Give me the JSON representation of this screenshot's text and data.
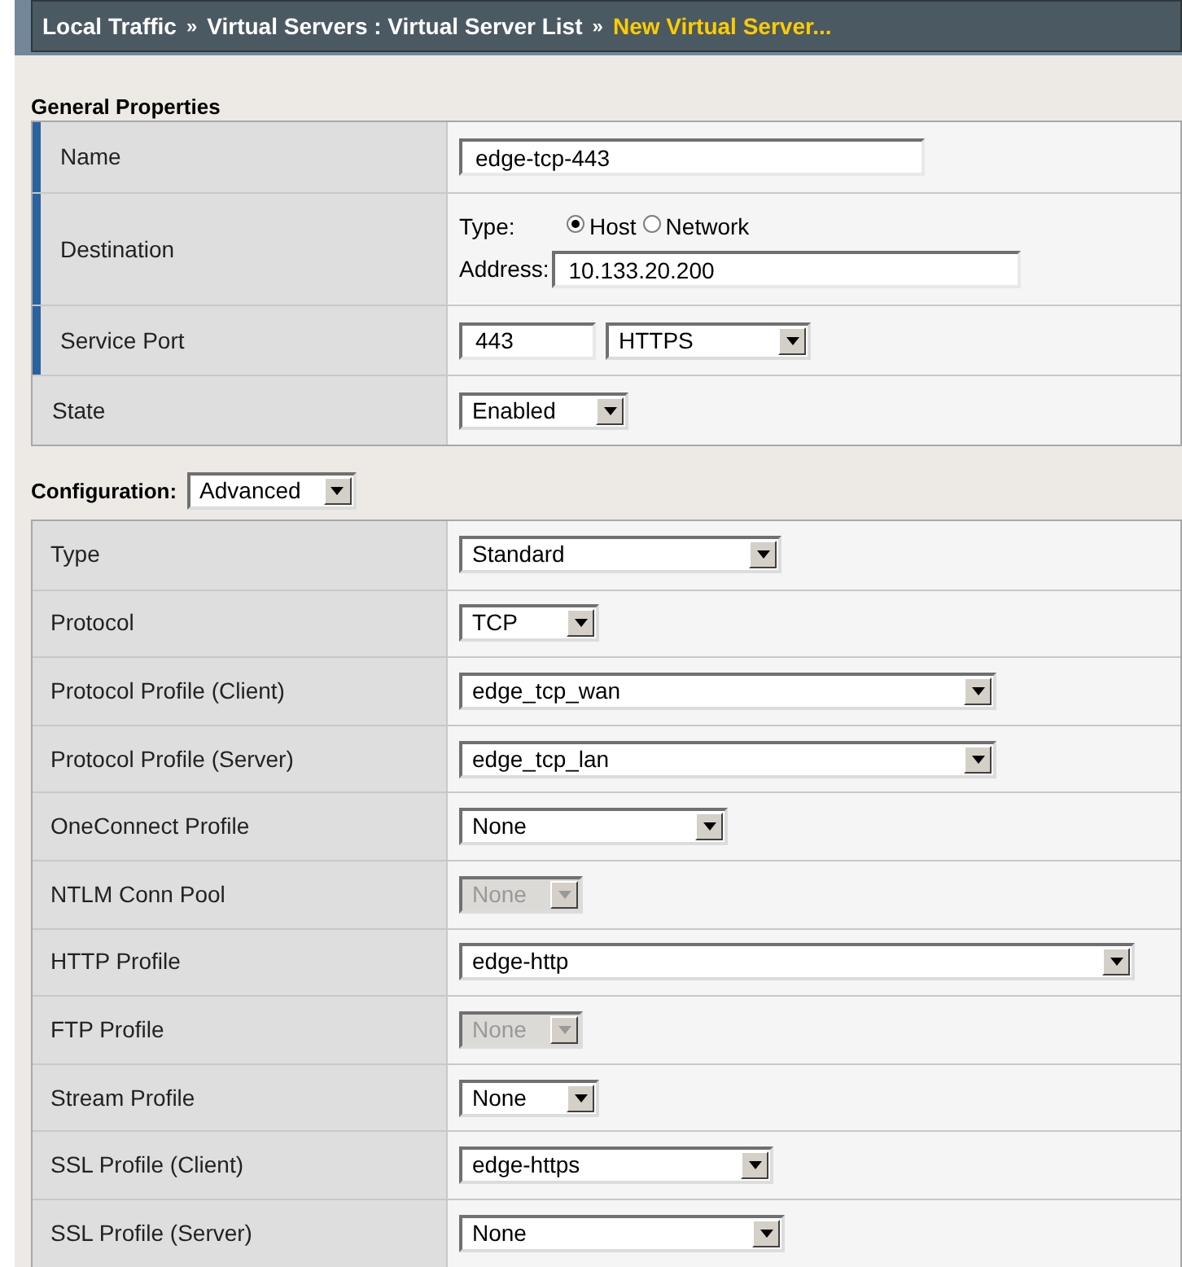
{
  "breadcrumb": [
    {
      "kind": "link",
      "text": "Local Traffic"
    },
    {
      "kind": "separator",
      "text": "»"
    },
    {
      "kind": "link",
      "text": "Virtual Servers : Virtual Server List"
    },
    {
      "kind": "separator",
      "text": "»"
    },
    {
      "kind": "current",
      "text": "New Virtual Server..."
    }
  ],
  "general": {
    "title": "General Properties",
    "rows": [
      {
        "label": "Name",
        "required": true,
        "kind": "text",
        "value": "edge-tcp-443"
      },
      {
        "label": "Destination",
        "required": true,
        "kind": "destination",
        "type_label": "Type:",
        "options": [
          {
            "label": "Host",
            "selected": true
          },
          {
            "label": "Network",
            "selected": false
          }
        ],
        "address_label": "Address:",
        "address": "10.133.20.200"
      },
      {
        "label": "Service Port",
        "required": true,
        "kind": "port",
        "port": "443",
        "service": "HTTPS"
      },
      {
        "label": "State",
        "required": false,
        "kind": "select",
        "value": "Enabled"
      }
    ]
  },
  "configuration": {
    "title": "Configuration:",
    "mode": "Advanced",
    "rows": [
      {
        "label": "Type",
        "value": "Standard",
        "disabled": false
      },
      {
        "label": "Protocol",
        "value": "TCP",
        "disabled": false
      },
      {
        "label": "Protocol Profile (Client)",
        "value": "edge_tcp_wan",
        "disabled": false
      },
      {
        "label": "Protocol Profile (Server)",
        "value": "edge_tcp_lan",
        "disabled": false
      },
      {
        "label": "OneConnect Profile",
        "value": "None",
        "disabled": false
      },
      {
        "label": "NTLM Conn Pool",
        "value": "None",
        "disabled": true
      },
      {
        "label": "HTTP Profile",
        "value": "edge-http",
        "disabled": false
      },
      {
        "label": "FTP Profile",
        "value": "None",
        "disabled": true
      },
      {
        "label": "Stream Profile",
        "value": "None",
        "disabled": false
      },
      {
        "label": "SSL Profile (Client)",
        "value": "edge-https",
        "disabled": false
      },
      {
        "label": "SSL Profile (Server)",
        "value": "None",
        "disabled": false
      }
    ]
  }
}
